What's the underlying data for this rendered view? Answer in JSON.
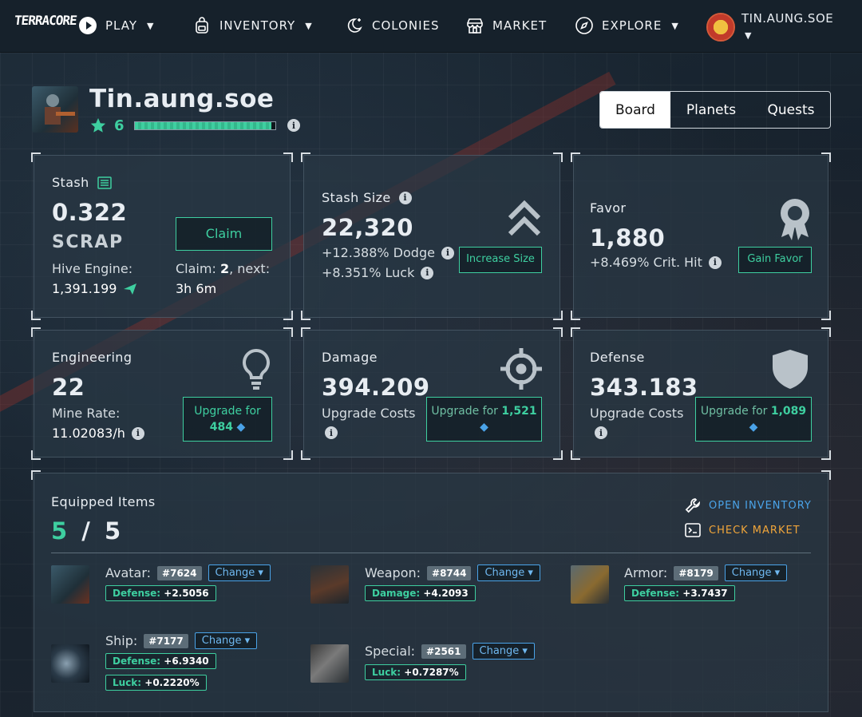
{
  "nav": {
    "logo": "TERRACORE",
    "items": [
      {
        "label": "PLAY",
        "icon": "play-icon",
        "caret": true
      },
      {
        "label": "INVENTORY",
        "icon": "backpack-icon",
        "caret": true
      },
      {
        "label": "COLONIES",
        "icon": "moon-star-icon",
        "caret": false
      },
      {
        "label": "MARKET",
        "icon": "store-icon",
        "caret": false
      },
      {
        "label": "EXPLORE",
        "icon": "compass-icon",
        "caret": true
      }
    ],
    "user": "TIN.AUNG.SOE"
  },
  "profile": {
    "name": "Tin.aung.soe",
    "level": "6",
    "xp_fraction": 0.97
  },
  "tabs": [
    "Board",
    "Planets",
    "Quests"
  ],
  "stash": {
    "title": "Stash",
    "value": "0.322",
    "unit": "SCRAP",
    "hive_label": "Hive Engine:",
    "hive_value": "1,391.199",
    "claim_button": "Claim",
    "claim_prefix": "Claim: ",
    "claim_count": "2",
    "claim_next": ", next:",
    "claim_time": "3h 6m"
  },
  "stash_size": {
    "title": "Stash Size",
    "value": "22,320",
    "dodge": "+12.388% Dodge",
    "luck": "+8.351% Luck",
    "button": "Increase Size"
  },
  "favor": {
    "title": "Favor",
    "value": "1,880",
    "crit": "+8.469% Crit. Hit",
    "button": "Gain Favor"
  },
  "engineering": {
    "title": "Engineering",
    "value": "22",
    "rate_label": "Mine Rate:",
    "rate_value": "11.02083/h",
    "button_label": "Upgrade for",
    "button_cost": "484"
  },
  "damage": {
    "title": "Damage",
    "value": "394.209",
    "cost_label": "Upgrade Costs",
    "button_label": "Upgrade for",
    "button_cost": "1,521"
  },
  "defense": {
    "title": "Defense",
    "value": "343.183",
    "cost_label": "Upgrade Costs",
    "button_label": "Upgrade for",
    "button_cost": "1,089"
  },
  "equipped": {
    "title": "Equipped Items",
    "count": "5",
    "total": "5",
    "open_inventory": "OPEN INVENTORY",
    "check_market": "CHECK MARKET",
    "change_label": "Change",
    "items": [
      {
        "slot": "Avatar:",
        "id": "#7624",
        "stats": [
          {
            "label": "Defense:",
            "value": "+2.5056"
          }
        ]
      },
      {
        "slot": "Weapon:",
        "id": "#8744",
        "stats": [
          {
            "label": "Damage:",
            "value": "+4.2093"
          }
        ]
      },
      {
        "slot": "Armor:",
        "id": "#8179",
        "stats": [
          {
            "label": "Defense:",
            "value": "+3.7437"
          }
        ]
      },
      {
        "slot": "Ship:",
        "id": "#7177",
        "stats": [
          {
            "label": "Defense:",
            "value": "+6.9340"
          },
          {
            "label": "Luck:",
            "value": "+0.2220%"
          }
        ]
      },
      {
        "slot": "Special:",
        "id": "#2561",
        "stats": [
          {
            "label": "Luck:",
            "value": "+0.7287%"
          }
        ]
      }
    ]
  },
  "colors": {
    "accent_green": "#3ecfa0",
    "accent_blue": "#4aa3e8",
    "accent_orange": "#f0a53a"
  }
}
